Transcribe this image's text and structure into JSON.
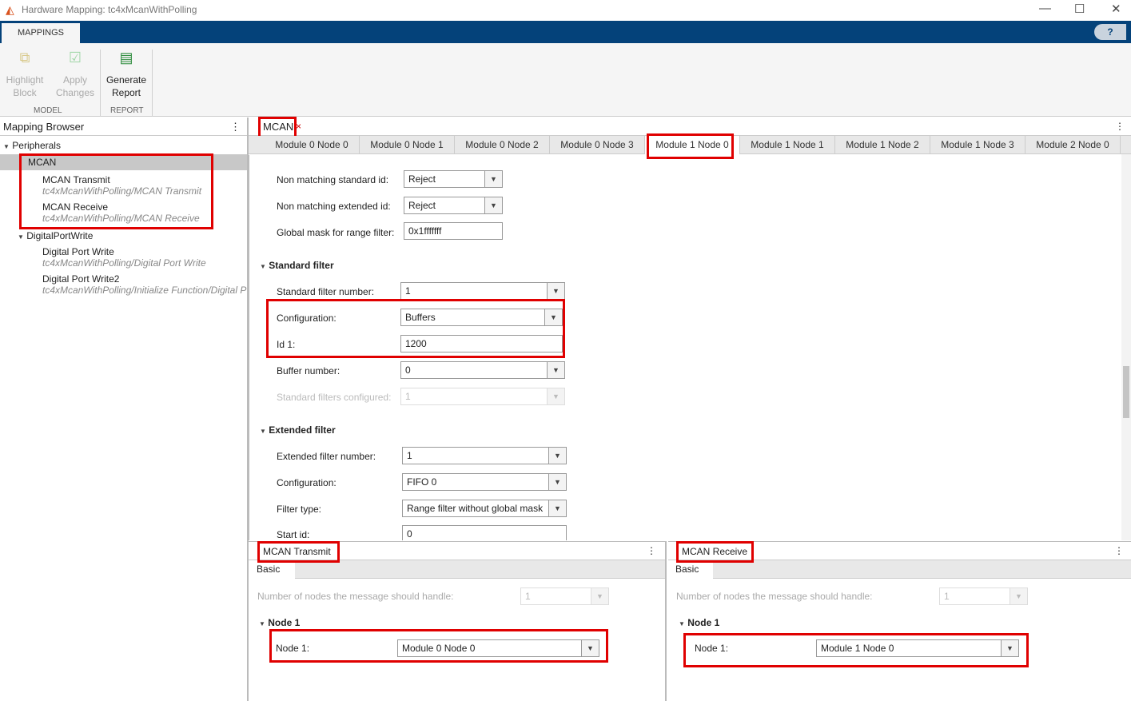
{
  "window": {
    "title": "Hardware Mapping: tc4xMcanWithPolling",
    "minimize": "—",
    "maximize": "☐",
    "close": "✕"
  },
  "ribbon": {
    "tab": "MAPPINGS",
    "help": "?",
    "highlight": [
      "Highlight",
      "Block"
    ],
    "apply": [
      "Apply",
      "Changes"
    ],
    "generate": [
      "Generate",
      "Report"
    ],
    "section_model": "MODEL",
    "section_report": "REPORT"
  },
  "browser": {
    "title": "Mapping Browser",
    "menu": "⋮",
    "peripherals": "Peripherals",
    "mcan": "MCAN",
    "items": [
      {
        "name": "MCAN Transmit",
        "path": "tc4xMcanWithPolling/MCAN Transmit"
      },
      {
        "name": "MCAN Receive",
        "path": "tc4xMcanWithPolling/MCAN Receive"
      }
    ],
    "dpw": "DigitalPortWrite",
    "dpw_items": [
      {
        "name": "Digital Port Write",
        "path": "tc4xMcanWithPolling/Digital Port Write"
      },
      {
        "name": "Digital Port Write2",
        "path": "tc4xMcanWithPolling/Initialize Function/Digital P"
      }
    ]
  },
  "doc": {
    "tab": "MCAN",
    "close": "×",
    "menu": "⋮",
    "node_tabs": [
      "Module 0 Node 0",
      "Module 0 Node 1",
      "Module 0 Node 2",
      "Module 0 Node 3",
      "Module 1 Node 0",
      "Module 1 Node 1",
      "Module 1 Node 2",
      "Module 1 Node 3",
      "Module 2 Node 0"
    ],
    "fields": {
      "nm_std_label": "Non matching standard id:",
      "nm_std": "Reject",
      "nm_ext_label": "Non matching extended id:",
      "nm_ext": "Reject",
      "gmask_label": "Global mask for range filter:",
      "gmask": "0x1fffffff",
      "std_header": "Standard filter",
      "std_num_label": "Standard filter number:",
      "std_num": "1",
      "std_cfg_label": "Configuration:",
      "std_cfg": "Buffers",
      "id1_label": "Id 1:",
      "id1": "1200",
      "buf_label": "Buffer number:",
      "buf": "0",
      "std_conf_label": "Standard filters configured:",
      "std_conf": "1",
      "ext_header": "Extended filter",
      "ext_num_label": "Extended filter number:",
      "ext_num": "1",
      "ext_cfg_label": "Configuration:",
      "ext_cfg": "FIFO 0",
      "ftype_label": "Filter type:",
      "ftype": "Range filter without global mask",
      "start_label": "Start id:",
      "start": "0"
    }
  },
  "tx": {
    "tab": "MCAN Transmit",
    "basic": "Basic",
    "nodes_label": "Number of nodes the message should handle:",
    "nodes": "1",
    "node_header": "Node 1",
    "node_label": "Node 1:",
    "node": "Module 0 Node 0"
  },
  "rx": {
    "tab": "MCAN Receive",
    "basic": "Basic",
    "nodes_label": "Number of nodes the message should handle:",
    "nodes": "1",
    "node_header": "Node 1",
    "node_label": "Node 1:",
    "node": "Module 1 Node 0"
  }
}
